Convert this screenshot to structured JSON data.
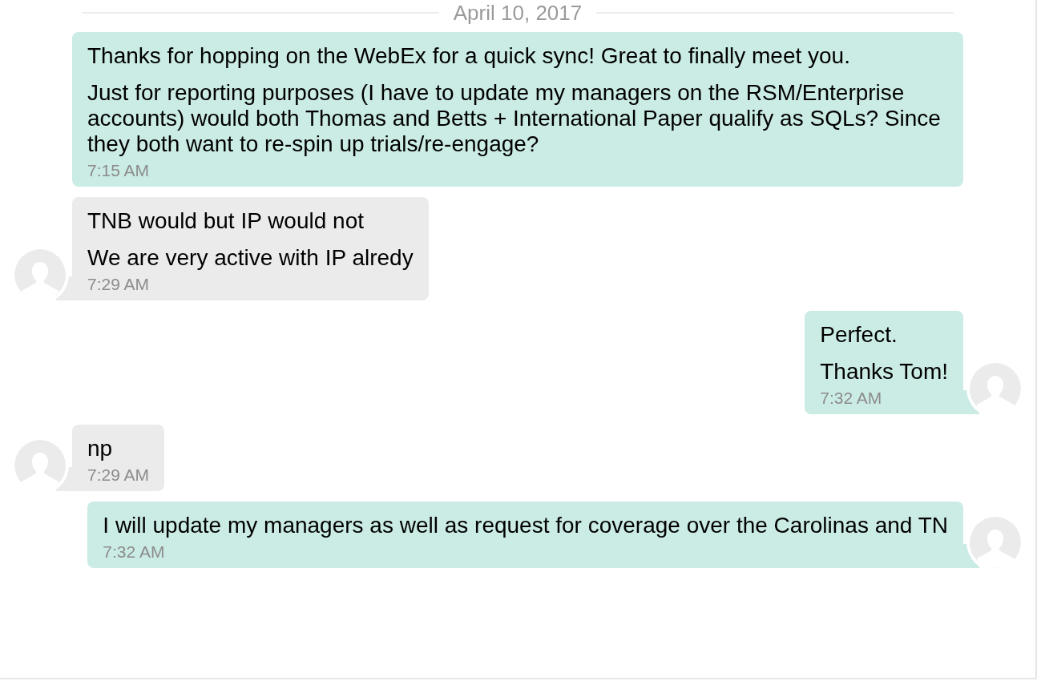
{
  "date_divider": {
    "label": "April 10, 2017"
  },
  "messages": [
    {
      "kind": "outgoing",
      "avatar": false,
      "paragraphs": [
        "Thanks for hopping on the WebEx for a quick sync! Great to finally meet you.",
        "Just for reporting purposes (I have to update my managers on the RSM/Enterprise accounts) would both Thomas and Betts + International Paper qualify as SQLs? Since they both want to re-spin up trials/re-engage?"
      ],
      "time": "7:15 AM"
    },
    {
      "kind": "incoming",
      "avatar": true,
      "paragraphs": [
        "TNB would but IP would not",
        "We are very active with IP alredy"
      ],
      "time": "7:29 AM"
    },
    {
      "kind": "outgoing",
      "avatar": true,
      "paragraphs": [
        "Perfect.",
        "Thanks Tom!"
      ],
      "time": "7:32 AM"
    },
    {
      "kind": "incoming",
      "avatar": true,
      "paragraphs": [
        "np"
      ],
      "time": "7:29 AM"
    },
    {
      "kind": "outgoing",
      "avatar": true,
      "paragraphs": [
        "I will update my managers as well as request for coverage over the Carolinas and TN"
      ],
      "time": "7:32 AM"
    }
  ]
}
